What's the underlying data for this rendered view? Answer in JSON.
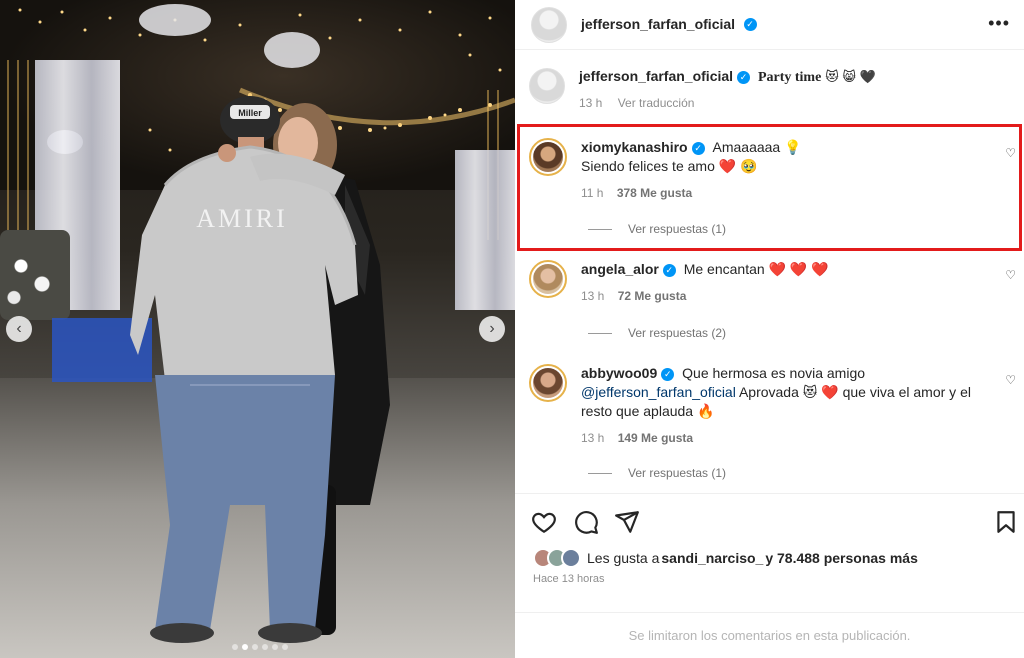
{
  "post": {
    "author": "jefferson_farfan_oficial",
    "menu_icon": "more-horizontal-icon"
  },
  "caption": {
    "author": "jefferson_farfan_oficial",
    "text": "Party time",
    "emojis": "😻 😸 🖤",
    "time": "13 h",
    "translate": "Ver traducción"
  },
  "comments": [
    {
      "user": "xiomykanashiro",
      "text_line1": "Amaaaaaa 💡",
      "text_line2": "Siendo felices te amo ❤️ 🥹",
      "time": "11 h",
      "likes": "378 Me gusta",
      "replies": "Ver respuestas (1)"
    },
    {
      "user": "angela_alor",
      "text_line1": "Me encantan ❤️ ❤️ ❤️",
      "time": "13 h",
      "likes": "72 Me gusta",
      "replies": "Ver respuestas (2)"
    },
    {
      "user": "abbywoo09",
      "text_line1": "Que hermosa es novia amigo",
      "mention": "@jefferson_farfan_oficial",
      "text_line2": " Aprovada 😻 ❤️  que viva el amor y el",
      "text_line3": "resto que aplauda 🔥",
      "time": "13 h",
      "likes": "149 Me gusta",
      "replies": "Ver respuestas (1)"
    }
  ],
  "likes": {
    "prefix": "Les gusta a ",
    "user": "sandi_narciso_",
    "suffix": " y 78.488 personas más"
  },
  "time_ago": "Hace 13 horas",
  "footer": "Se limitaron los comentarios en esta publicación.",
  "photo": {
    "shirt_text": "AMIRI",
    "cap_text": "Miller",
    "prev_icon": "chevron-left-icon",
    "next_icon": "chevron-right-icon"
  },
  "colors": {
    "highlight": "#e31b1b",
    "verified": "#0095f6",
    "mention": "#00376b"
  }
}
